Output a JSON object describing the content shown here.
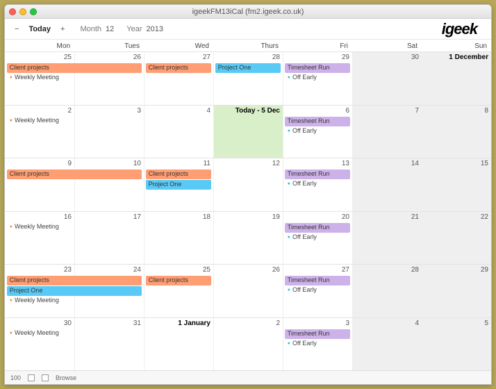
{
  "window_title": "igeekFM13iCal (fm2.igeek.co.uk)",
  "toolbar": {
    "minus": "−",
    "today": "Today",
    "plus": "+",
    "month_label": "Month",
    "month_value": "12",
    "year_label": "Year",
    "year_value": "2013"
  },
  "logo": "igeek",
  "dayheads": [
    "Mon",
    "Tues",
    "Wed",
    "Thurs",
    "Fri",
    "Sat",
    "Sun"
  ],
  "weeks": [
    {
      "dates": [
        "25",
        "26",
        "27",
        "28",
        "29",
        "30",
        "1 December"
      ],
      "strong": [
        6
      ],
      "today": null,
      "bars": [
        {
          "row": 0,
          "colStart": 0,
          "span": 2,
          "class": "orange",
          "label": "Client projects"
        },
        {
          "row": 0,
          "colStart": 2,
          "span": 1,
          "class": "orange",
          "label": "Client projects"
        },
        {
          "row": 0,
          "colStart": 3,
          "span": 1,
          "class": "blue",
          "label": "Project One"
        },
        {
          "row": 0,
          "colStart": 4,
          "span": 1,
          "class": "purple",
          "label": "Timesheet Run"
        }
      ],
      "pips": [
        {
          "col": 0,
          "row": 1,
          "class": "dor",
          "label": "Weekly Meeting"
        },
        {
          "col": 4,
          "row": 1,
          "class": "dcy",
          "label": "Off Early"
        }
      ]
    },
    {
      "dates": [
        "2",
        "3",
        "4",
        "Today - 5 Dec",
        "6",
        "7",
        "8"
      ],
      "strong": [
        3
      ],
      "today": 3,
      "bars": [
        {
          "row": 0,
          "colStart": 4,
          "span": 1,
          "class": "purple",
          "label": "Timesheet Run"
        }
      ],
      "pips": [
        {
          "col": 0,
          "row": 0,
          "class": "dor",
          "label": "Weekly Meeting"
        },
        {
          "col": 4,
          "row": 1,
          "class": "dcy",
          "label": "Off Early"
        }
      ]
    },
    {
      "dates": [
        "9",
        "10",
        "11",
        "12",
        "13",
        "14",
        "15"
      ],
      "strong": [],
      "today": null,
      "bars": [
        {
          "row": 0,
          "colStart": 0,
          "span": 2,
          "class": "orange",
          "label": "Client projects"
        },
        {
          "row": 0,
          "colStart": 2,
          "span": 1,
          "class": "orange",
          "label": "Client projects"
        },
        {
          "row": 1,
          "colStart": 2,
          "span": 1,
          "class": "blue",
          "label": "Project One"
        },
        {
          "row": 0,
          "colStart": 4,
          "span": 1,
          "class": "purple",
          "label": "Timesheet Run"
        }
      ],
      "pips": [
        {
          "col": 4,
          "row": 1,
          "class": "dcy",
          "label": "Off Early"
        }
      ]
    },
    {
      "dates": [
        "16",
        "17",
        "18",
        "19",
        "20",
        "21",
        "22"
      ],
      "strong": [],
      "today": null,
      "bars": [
        {
          "row": 0,
          "colStart": 4,
          "span": 1,
          "class": "purple",
          "label": "Timesheet Run"
        }
      ],
      "pips": [
        {
          "col": 0,
          "row": 0,
          "class": "dor",
          "label": "Weekly Meeting"
        },
        {
          "col": 4,
          "row": 1,
          "class": "dcy",
          "label": "Off Early"
        }
      ]
    },
    {
      "dates": [
        "23",
        "24",
        "25",
        "26",
        "27",
        "28",
        "29"
      ],
      "strong": [],
      "today": null,
      "bars": [
        {
          "row": 0,
          "colStart": 0,
          "span": 2,
          "class": "orange",
          "label": "Client projects"
        },
        {
          "row": 0,
          "colStart": 2,
          "span": 1,
          "class": "orange",
          "label": "Client projects"
        },
        {
          "row": 1,
          "colStart": 0,
          "span": 2,
          "class": "blue",
          "label": "Project One"
        },
        {
          "row": 0,
          "colStart": 4,
          "span": 1,
          "class": "purple",
          "label": "Timesheet Run"
        }
      ],
      "pips": [
        {
          "col": 0,
          "row": 2,
          "class": "dor",
          "label": "Weekly Meeting"
        },
        {
          "col": 4,
          "row": 1,
          "class": "dcy",
          "label": "Off Early"
        }
      ]
    },
    {
      "dates": [
        "30",
        "31",
        "1 January",
        "2",
        "3",
        "4",
        "5"
      ],
      "strong": [
        2
      ],
      "today": null,
      "bars": [
        {
          "row": 0,
          "colStart": 4,
          "span": 1,
          "class": "purple",
          "label": "Timesheet Run"
        }
      ],
      "pips": [
        {
          "col": 0,
          "row": 0,
          "class": "dor",
          "label": "Weekly Meeting"
        },
        {
          "col": 4,
          "row": 1,
          "class": "dcy",
          "label": "Off Early"
        }
      ]
    }
  ],
  "footer": {
    "zoom": "100",
    "browse": "Browse"
  }
}
